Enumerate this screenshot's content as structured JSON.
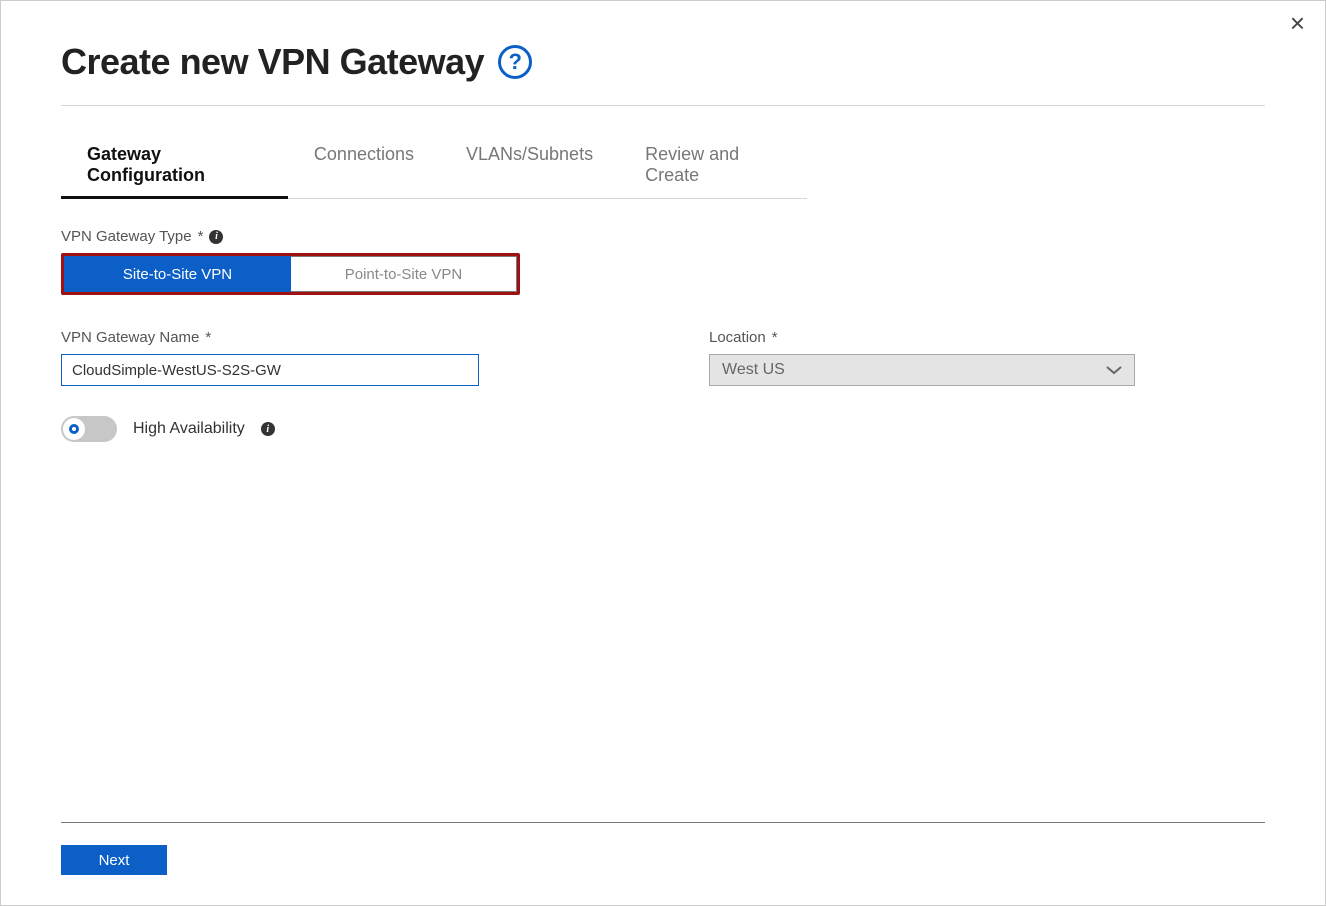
{
  "header": {
    "title": "Create new VPN Gateway"
  },
  "tabs": {
    "items": [
      {
        "label": "Gateway Configuration",
        "active": true
      },
      {
        "label": "Connections",
        "active": false
      },
      {
        "label": "VLANs/Subnets",
        "active": false
      },
      {
        "label": "Review and Create",
        "active": false
      }
    ]
  },
  "gateway_type": {
    "label": "VPN Gateway Type",
    "required_mark": "*",
    "options": {
      "site_to_site": "Site-to-Site VPN",
      "point_to_site": "Point-to-Site VPN"
    },
    "selected": "site_to_site"
  },
  "gateway_name": {
    "label": "VPN Gateway Name",
    "required_mark": "*",
    "value": "CloudSimple-WestUS-S2S-GW"
  },
  "location": {
    "label": "Location",
    "required_mark": "*",
    "value": "West US"
  },
  "high_availability": {
    "label": "High Availability",
    "enabled": false
  },
  "footer": {
    "next": "Next"
  }
}
